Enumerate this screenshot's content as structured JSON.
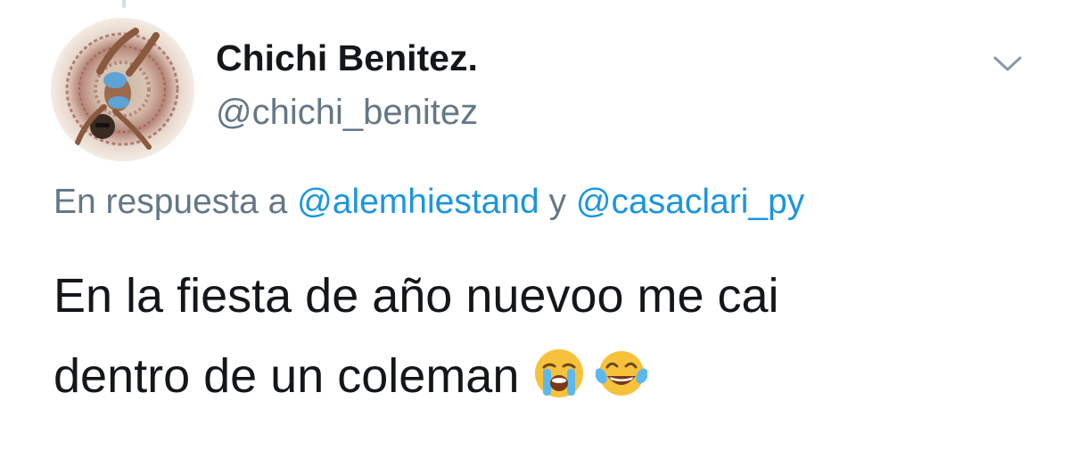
{
  "tweet": {
    "author": {
      "display_name": "Chichi Benitez.",
      "handle": "@chichi_benitez",
      "avatar_icon": "profile-photo-avatar"
    },
    "menu_icon": "chevron-down-icon",
    "reply": {
      "prefix": "En respuesta a ",
      "mention_1": "@alemhiestand",
      "joiner": " y ",
      "mention_2": "@casaclari_py"
    },
    "text_line_1": "En la fiesta de año nuevoo me cai",
    "text_line_2": "dentro de un coleman",
    "emojis": [
      "loudly-crying-face-emoji",
      "face-with-tears-of-joy-emoji"
    ]
  },
  "colors": {
    "text_primary": "#14171a",
    "text_secondary": "#657786",
    "link": "#1b95e0",
    "chevron": "#8899a6"
  }
}
